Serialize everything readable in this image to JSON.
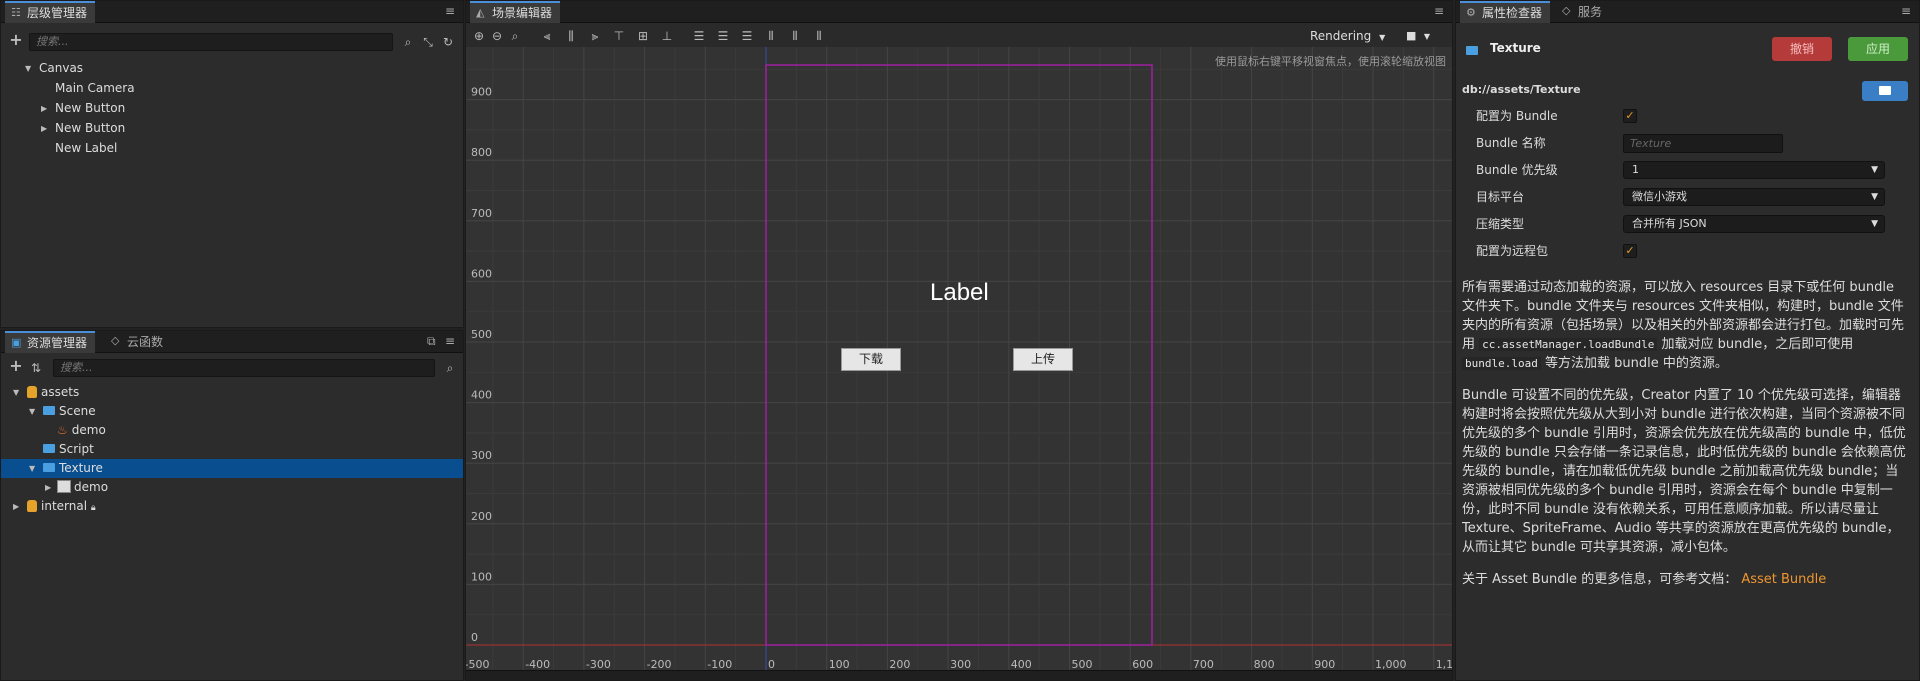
{
  "hierarchy": {
    "tab_label": "层级管理器",
    "search_placeholder": "搜索...",
    "items": [
      "Canvas",
      "Main Camera",
      "New Button",
      "New Button",
      "New Label"
    ]
  },
  "assets": {
    "tab_label": "资源管理器",
    "tab2_label": "云函数",
    "search_placeholder": "搜索...",
    "items": [
      "assets",
      "Scene",
      "demo",
      "Script",
      "Texture",
      "demo",
      "internal"
    ]
  },
  "scene": {
    "tab_label": "场景编辑器",
    "rendering_label": "Rendering",
    "hint": "使用鼠标右键平移视窗焦点，使用滚轮缩放视图",
    "label_text": "Label",
    "button1": "下载",
    "button2": "上传",
    "y_ticks": [
      "900",
      "800",
      "700",
      "600",
      "500",
      "400",
      "300",
      "200",
      "100",
      "0"
    ],
    "x_ticks": [
      "-500",
      "-400",
      "-300",
      "-200",
      "-100",
      "0",
      "100",
      "200",
      "300",
      "400",
      "500",
      "600",
      "700",
      "800",
      "900",
      "1,000",
      "1,1"
    ]
  },
  "inspector": {
    "tab_label": "属性检查器",
    "tab2_label": "服务",
    "title": "Texture",
    "revert_label": "撤销",
    "apply_label": "应用",
    "path": "db://assets/Texture",
    "props": {
      "is_bundle_label": "配置为 Bundle",
      "bundle_name_label": "Bundle 名称",
      "bundle_name_placeholder": "Texture",
      "priority_label": "Bundle 优先级",
      "priority_value": "1",
      "platform_label": "目标平台",
      "platform_value": "微信小游戏",
      "compress_label": "压缩类型",
      "compress_value": "合并所有 JSON",
      "remote_label": "配置为远程包"
    },
    "para1_a": "所有需要通过动态加载的资源，可以放入 resources 目录下或任何 bundle 文件夹下。bundle 文件夹与 resources 文件夹相似，构建时，bundle 文件夹内的所有资源（包括场景）以及相关的外部资源都会进行打包。加载时可先用",
    "para1_code1": "cc.assetManager.loadBundle",
    "para1_b": "加载对应 bundle，之后即可使用",
    "para1_code2": "bundle.load",
    "para1_c": "等方法加载 bundle 中的资源。",
    "para2": "Bundle 可设置不同的优先级，Creator 内置了 10 个优先级可选择，编辑器构建时将会按照优先级从大到小对 bundle 进行依次构建，当同个资源被不同优先级的多个 bundle 引用时，资源会优先放在优先级高的 bundle 中，低优先级的 bundle 只会存储一条记录信息，此时低优先级的 bundle 会依赖高优先级的 bundle，请在加载低优先级 bundle 之前加载高优先级 bundle；当资源被相同优先级的多个 bundle 引用时，资源会在每个 bundle 中复制一份，此时不同 bundle 没有依赖关系，可用任意顺序加载。所以请尽量让 Texture、SpriteFrame、Audio 等共享的资源放在更高优先级的 bundle，从而让其它 bundle 可共享其资源，减小包体。",
    "para3_text": "关于 Asset Bundle 的更多信息，可参考文档：",
    "para3_link": "Asset Bundle"
  }
}
